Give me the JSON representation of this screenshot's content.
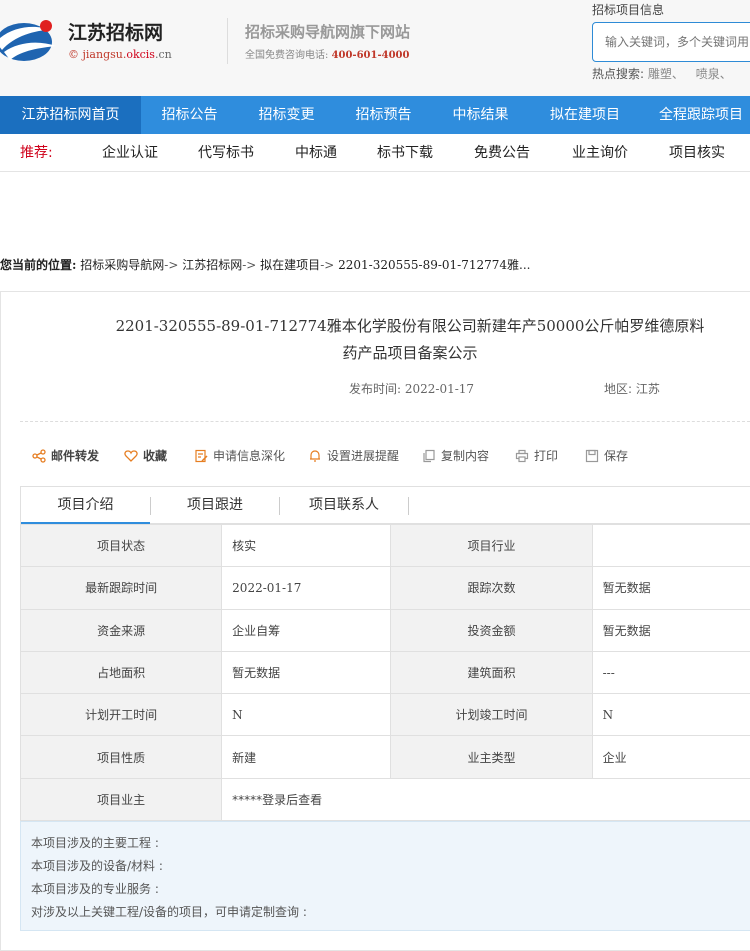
{
  "header": {
    "site_title": "江苏招标网",
    "site_url_prefix": "© jiangsu.",
    "site_url_brand": "okcis",
    "site_url_suffix": ".cn",
    "slogan": "招标采购导航网旗下网站",
    "hotline_label": "全国免费咨询电话:",
    "hotline_number": "400-601-4000",
    "search_label": "招标项目信息",
    "search_placeholder": "输入关键词，多个关键词用",
    "hot_label": "热点搜索:",
    "hot_items": [
      "雕塑、",
      "喷泉、"
    ]
  },
  "nav": {
    "items": [
      "江苏招标网首页",
      "招标公告",
      "招标变更",
      "招标预告",
      "中标结果",
      "拟在建项目",
      "全程跟踪项目"
    ],
    "active_index": 0
  },
  "recommend": {
    "label": "推荐:",
    "items": [
      "企业认证",
      "代写标书",
      "中标通",
      "标书下载",
      "免费公告",
      "业主询价",
      "项目核实"
    ]
  },
  "breadcrumb": {
    "label": "您当前的位置:",
    "items": [
      "招标采购导航网",
      "江苏招标网",
      "拟在建项目",
      "2201-320555-89-01-712774雅..."
    ],
    "separator": "->"
  },
  "article": {
    "title_line1": "2201-320555-89-01-712774雅本化学股份有限公司新建年产50000公斤帕罗维德原料",
    "title_line2": "药产品项目备案公示",
    "publish_label": "发布时间:",
    "publish_date": "2022-01-17",
    "region_label": "地区:",
    "region": "江苏"
  },
  "toolbar": {
    "email": "邮件转发",
    "favorite": "收藏",
    "deepen": "申请信息深化",
    "reminder": "设置进展提醒",
    "copy": "复制内容",
    "print": "打印",
    "save": "保存"
  },
  "tabs": {
    "items": [
      "项目介绍",
      "项目跟进",
      "项目联系人"
    ],
    "active_index": 0
  },
  "table": {
    "rows": [
      {
        "k1": "项目状态",
        "v1": "核实",
        "k2": "项目行业",
        "v2": ""
      },
      {
        "k1": "最新跟踪时间",
        "v1": "2022-01-17",
        "k2": "跟踪次数",
        "v2": "暂无数据"
      },
      {
        "k1": "资金来源",
        "v1": "企业自筹",
        "k2": "投资金额",
        "v2": "暂无数据"
      },
      {
        "k1": "占地面积",
        "v1": "暂无数据",
        "k2": "建筑面积",
        "v2": "---"
      },
      {
        "k1": "计划开工时间",
        "v1": "N",
        "k2": "计划竣工时间",
        "v2": "N"
      },
      {
        "k1": "项目性质",
        "v1": "新建",
        "k2": "业主类型",
        "v2": "企业"
      },
      {
        "k1": "项目业主",
        "v1": "*****登录后查看"
      }
    ]
  },
  "notes": {
    "main_works": "本项目涉及的主要工程 :",
    "equipment": "本项目涉及的设备/材料 :",
    "services": "本项目涉及的专业服务 :",
    "custom_query": "对涉及以上关键工程/设备的项目，可申请定制查询 :"
  },
  "colors": {
    "nav_bg": "#2f8ddd",
    "nav_active": "#1b6fbf",
    "accent_red": "#d0021b"
  }
}
